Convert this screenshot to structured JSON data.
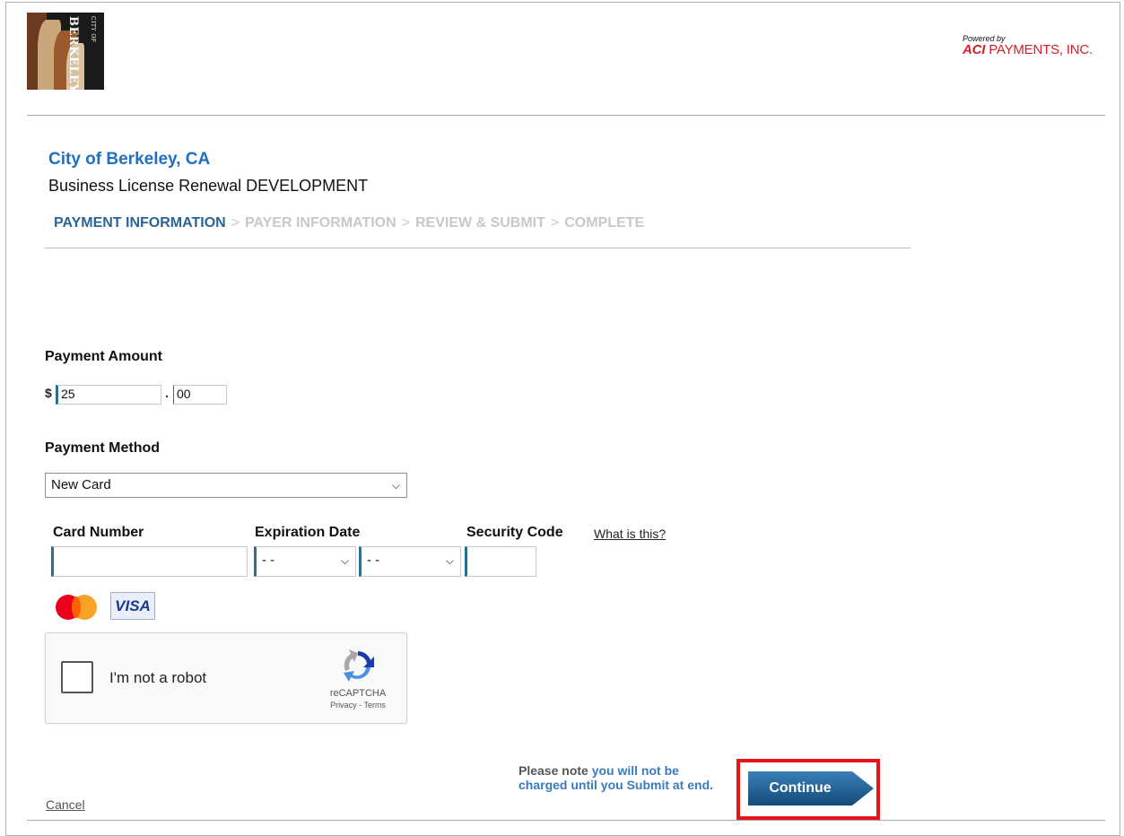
{
  "header": {
    "logo_top": "CITY OF",
    "logo_name": "BERKELEY",
    "powered_by": "Powered by",
    "aci_brand": "ACI",
    "aci_rest": "PAYMENTS, INC."
  },
  "org": {
    "name": "City of Berkeley, CA",
    "subtitle": "Business License Renewal DEVELOPMENT"
  },
  "steps": [
    "PAYMENT INFORMATION",
    "PAYER INFORMATION",
    "REVIEW & SUBMIT",
    "COMPLETE"
  ],
  "steps_separator": ">",
  "payment_amount": {
    "label": "Payment Amount",
    "currency": "$",
    "dollars": "25",
    "decimal": ".",
    "cents": "00"
  },
  "payment_method": {
    "label": "Payment Method",
    "selected": "New Card"
  },
  "card": {
    "number_label": "Card Number",
    "number_value": "",
    "expiration_label": "Expiration Date",
    "month_selected": "- -",
    "year_selected": "- -",
    "security_label": "Security Code",
    "security_value": "",
    "what_is_this": "What is this?"
  },
  "card_brands": [
    "mastercard-icon",
    "VISA"
  ],
  "captcha": {
    "label": "I'm not a robot",
    "brand": "reCAPTCHA",
    "privacy": "Privacy",
    "dash": "-",
    "terms": "Terms"
  },
  "footer": {
    "note_prefix": "Please note ",
    "note_highlight": "you will not be charged until you Submit at end.",
    "continue": "Continue",
    "cancel": "Cancel"
  },
  "colors": {
    "accent_blue": "#1f6fc5",
    "active_step": "#2a6496",
    "button": "#1d5a8a",
    "highlight_box": "#e3141c"
  }
}
